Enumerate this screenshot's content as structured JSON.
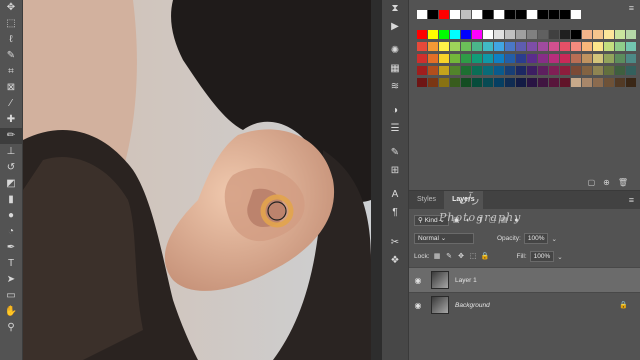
{
  "toolbar": {
    "tools": [
      "move-tool",
      "marquee-tool",
      "lasso-tool",
      "quick-select-tool",
      "crop-tool",
      "frame-tool",
      "eyedropper-tool",
      "spot-healing-tool",
      "brush-tool",
      "clone-stamp-tool",
      "history-brush-tool",
      "eraser-tool",
      "gradient-tool",
      "blur-tool",
      "dodge-tool",
      "pen-tool",
      "type-tool",
      "path-select-tool",
      "rectangle-tool",
      "hand-tool",
      "zoom-tool"
    ]
  },
  "swatches": {
    "colors_row1": [
      "#ffffff",
      "#000000",
      "#ff0000",
      "#ffffff",
      "#c0c0c0",
      "#ffffff",
      "#000000",
      "#ffffff",
      "#000000",
      "#000000",
      "#ffffff",
      "#000000",
      "#000000",
      "#000000",
      "#ffffff"
    ],
    "colors_row2": [
      "#ff0000",
      "#ffff00",
      "#00ff00",
      "#00ffff",
      "#0000ff",
      "#ff00ff",
      "#ffffff",
      "#e0e0e0",
      "#c0c0c0",
      "#a0a0a0",
      "#808080",
      "#606060",
      "#404040",
      "#202020",
      "#000000",
      "#f2b48a",
      "#f6c58d",
      "#fde69a",
      "#c9e59e",
      "#b5d7a8"
    ],
    "colors_row3": [
      "#e7493a",
      "#f39a35",
      "#fff248",
      "#9ed35a",
      "#6bbf59",
      "#4bb68b",
      "#41b9c4",
      "#41a6e3",
      "#4a78c6",
      "#5e5db0",
      "#7d4ea8",
      "#a04b9f",
      "#d0508e",
      "#e55067",
      "#f48b7e",
      "#f8b67a",
      "#fde58b",
      "#c4df7f",
      "#8fcd8a",
      "#72c6b0"
    ],
    "colors_row4": [
      "#cf2f2d",
      "#e46f27",
      "#f7d429",
      "#73b73a",
      "#2f9c47",
      "#119c78",
      "#0f98a8",
      "#0f80c4",
      "#235ea8",
      "#2b3d8e",
      "#5a2d8c",
      "#872e88",
      "#b82e7c",
      "#c92958",
      "#b96e55",
      "#bf9360",
      "#d3c57a",
      "#92a45c",
      "#5c8d5d",
      "#4d8a87"
    ],
    "colors_row5": [
      "#a01e1d",
      "#b14e1c",
      "#c5a31b",
      "#52842b",
      "#1e6f32",
      "#0b6e56",
      "#0a6b78",
      "#0a5b8c",
      "#183f76",
      "#1c2863",
      "#3c1e62",
      "#5d1f5f",
      "#801f55",
      "#8d1d3c",
      "#7b4a36",
      "#836342",
      "#8f8552",
      "#63703e",
      "#3f5f3f",
      "#34605d"
    ],
    "colors_row6": [
      "#6e1514",
      "#7a3613",
      "#887112",
      "#385c1d",
      "#144d22",
      "#074c3b",
      "#074a53",
      "#063f62",
      "#102c52",
      "#131b44",
      "#291443",
      "#401541",
      "#58153b",
      "#611429",
      "#c7a98a",
      "#a8876a",
      "#8b6b4f",
      "#6e5238",
      "#523a25",
      "#3a2716"
    ]
  },
  "layers_panel": {
    "tabs": [
      {
        "label": "Styles",
        "active": false
      },
      {
        "label": "Layers",
        "active": true
      }
    ],
    "filter_kind": "Kind",
    "blend_mode": "Normal",
    "opacity_label": "Opacity:",
    "opacity_value": "100%",
    "lock_label": "Lock:",
    "fill_label": "Fill:",
    "fill_value": "100%",
    "layers": [
      {
        "name": "Layer 1",
        "selected": true,
        "visible": true,
        "locked": false
      },
      {
        "name": "Background",
        "selected": false,
        "visible": true,
        "locked": true
      }
    ]
  },
  "watermark": {
    "top_text": "ر آن",
    "bottom_text": "Photography"
  }
}
